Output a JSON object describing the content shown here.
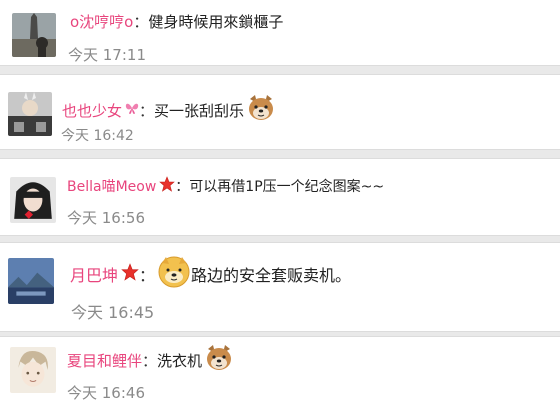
{
  "feed": {
    "items": [
      {
        "username": "o沈哼哼o",
        "badge": "",
        "colon": "：",
        "message": "健身時候用來鎖櫃子",
        "emoji": "",
        "time": "今天 17:11"
      },
      {
        "username": "也也少女",
        "badge": "butterfly-badge-icon",
        "colon": "：",
        "message": "买一张刮刮乐",
        "emoji": "dog-emoji-icon",
        "time": "今天 16:42"
      },
      {
        "username": "Bella喵Meow",
        "badge": "star-badge-icon",
        "colon": "：",
        "message": "可以再借1P压一个纪念图案~~",
        "emoji": "",
        "time": "今天 16:56"
      },
      {
        "username": "月巴坤",
        "badge": "star-badge-icon",
        "colon": "：",
        "message": "路边的安全套贩卖机。",
        "emoji": "doge-emoji-icon",
        "time": "今天 16:45"
      },
      {
        "username": "夏目和鲤伴",
        "badge": "",
        "colon": "：",
        "message": "洗衣机",
        "emoji": "dog-emoji-icon",
        "time": "今天 16:46"
      }
    ]
  },
  "colors": {
    "username": "#e8457d",
    "time": "#8a8a8a",
    "background": "#e9e9e9",
    "badge_star": "#e8312b"
  }
}
